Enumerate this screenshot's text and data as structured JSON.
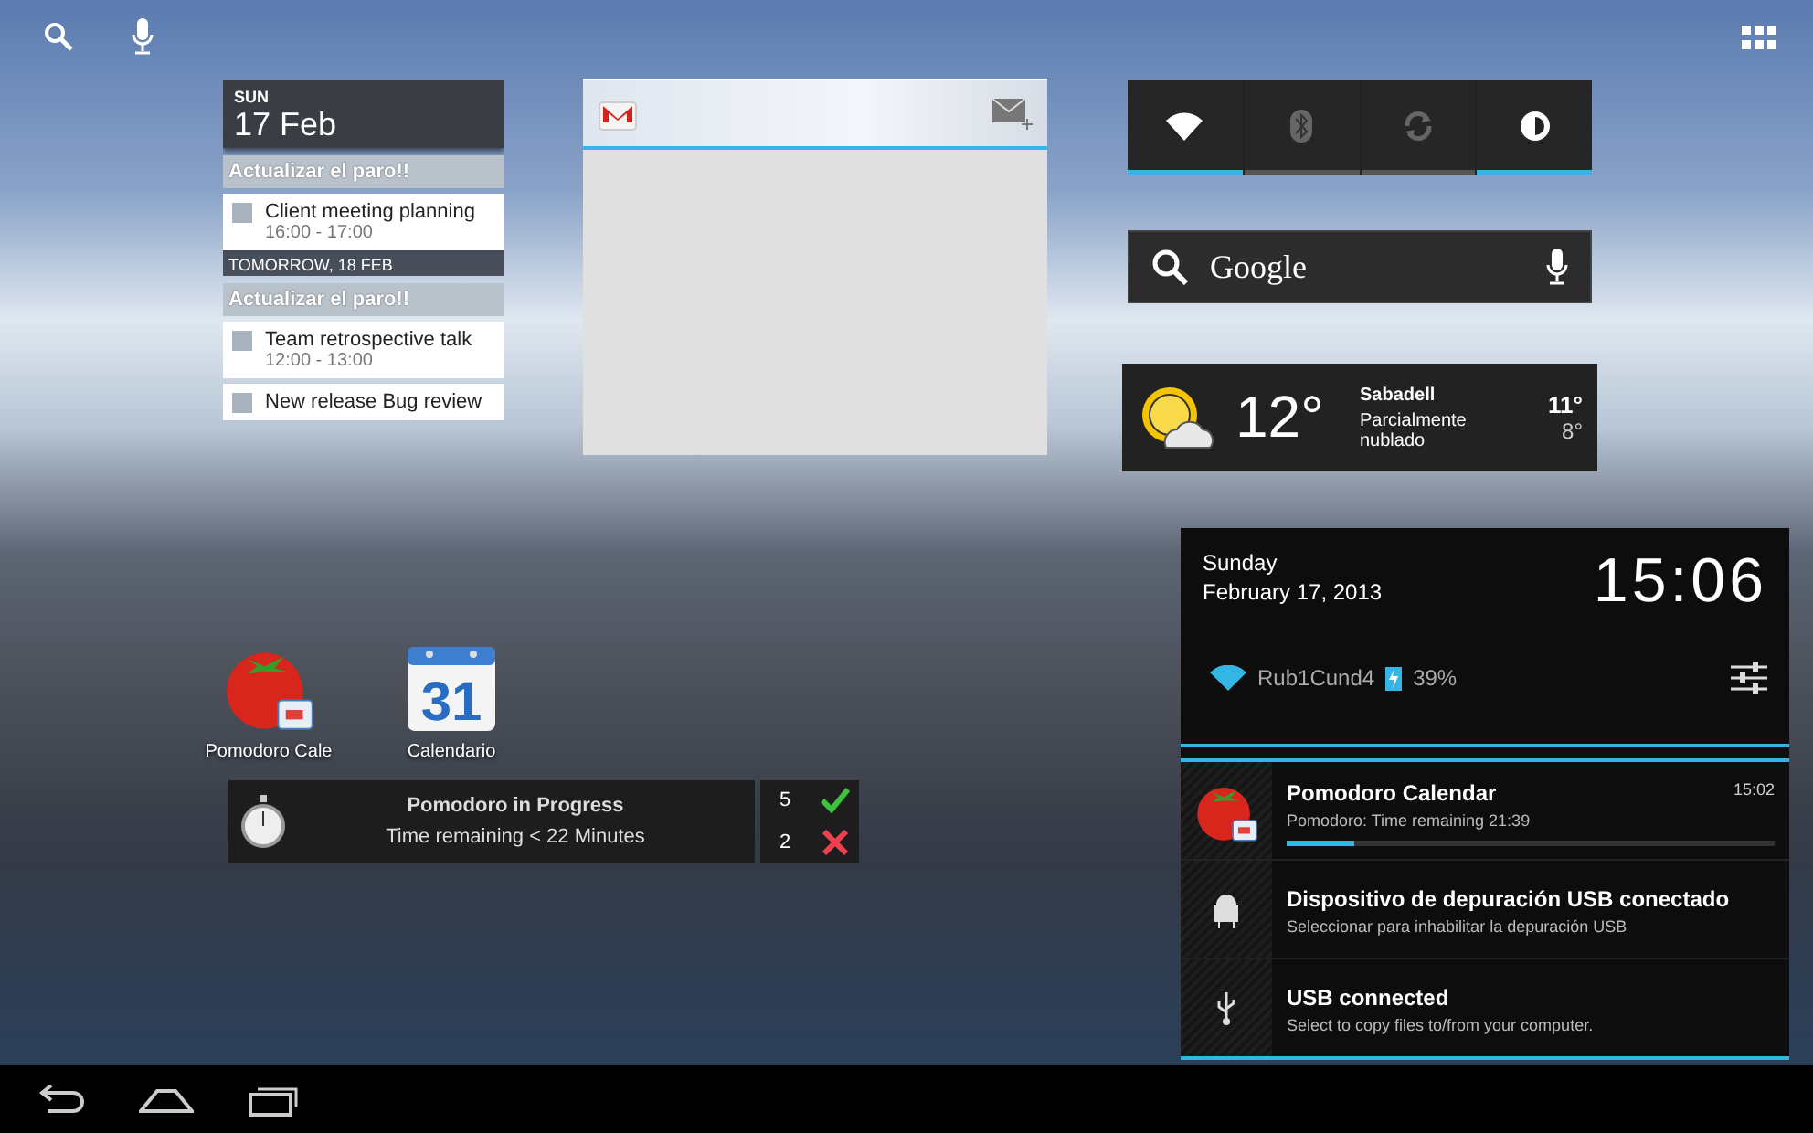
{
  "calendar_widget": {
    "weekday": "SUN",
    "date": "17 Feb",
    "items": [
      {
        "kind": "task",
        "text": "Actualizar el paro!!"
      },
      {
        "kind": "event",
        "title": "Client meeting planning",
        "time": "16:00 - 17:00"
      },
      {
        "kind": "day",
        "text": "TOMORROW, 18 FEB"
      },
      {
        "kind": "task",
        "text": "Actualizar el paro!!"
      },
      {
        "kind": "event",
        "title": "Team  retrospective talk",
        "time": "12:00 - 13:00"
      },
      {
        "kind": "event",
        "title": "New release Bug review"
      }
    ]
  },
  "quick_toggles": [
    {
      "kind": "wifi",
      "on": true
    },
    {
      "kind": "bluetooth",
      "on": false
    },
    {
      "kind": "sync",
      "on": false
    },
    {
      "kind": "brightness",
      "on": true
    }
  ],
  "search_widget": {
    "label": "Google"
  },
  "weather": {
    "temperature": "12°",
    "city": "Sabadell",
    "condition": "Parcialmente nublado",
    "high": "11°",
    "low": "8°"
  },
  "app_icons": [
    {
      "kind": "tomato",
      "label": "Pomodoro Cale"
    },
    {
      "kind": "calendar",
      "label": "Calendario",
      "day": "31"
    }
  ],
  "pomodoro_widget": {
    "title": "Pomodoro in Progress",
    "subtitle": "Time remaining < 22 Minutes",
    "done": "5",
    "failed": "2"
  },
  "notification_panel": {
    "weekday": "Sunday",
    "date": "February 17, 2013",
    "time": "15:06",
    "network": "Rub1Cund4",
    "battery": "39%",
    "notifications": [
      {
        "kind": "tomato",
        "title": "Pomodoro Calendar",
        "time": "15:02",
        "text": "Pomodoro: Time remaining 21:39",
        "level": 0.14
      },
      {
        "kind": "debug",
        "title": "Dispositivo de depuración USB conectado",
        "text": "Seleccionar para inhabilitar la depuración USB"
      },
      {
        "kind": "usb",
        "title": "USB connected",
        "text": "Select to copy files to/from your computer."
      }
    ]
  }
}
